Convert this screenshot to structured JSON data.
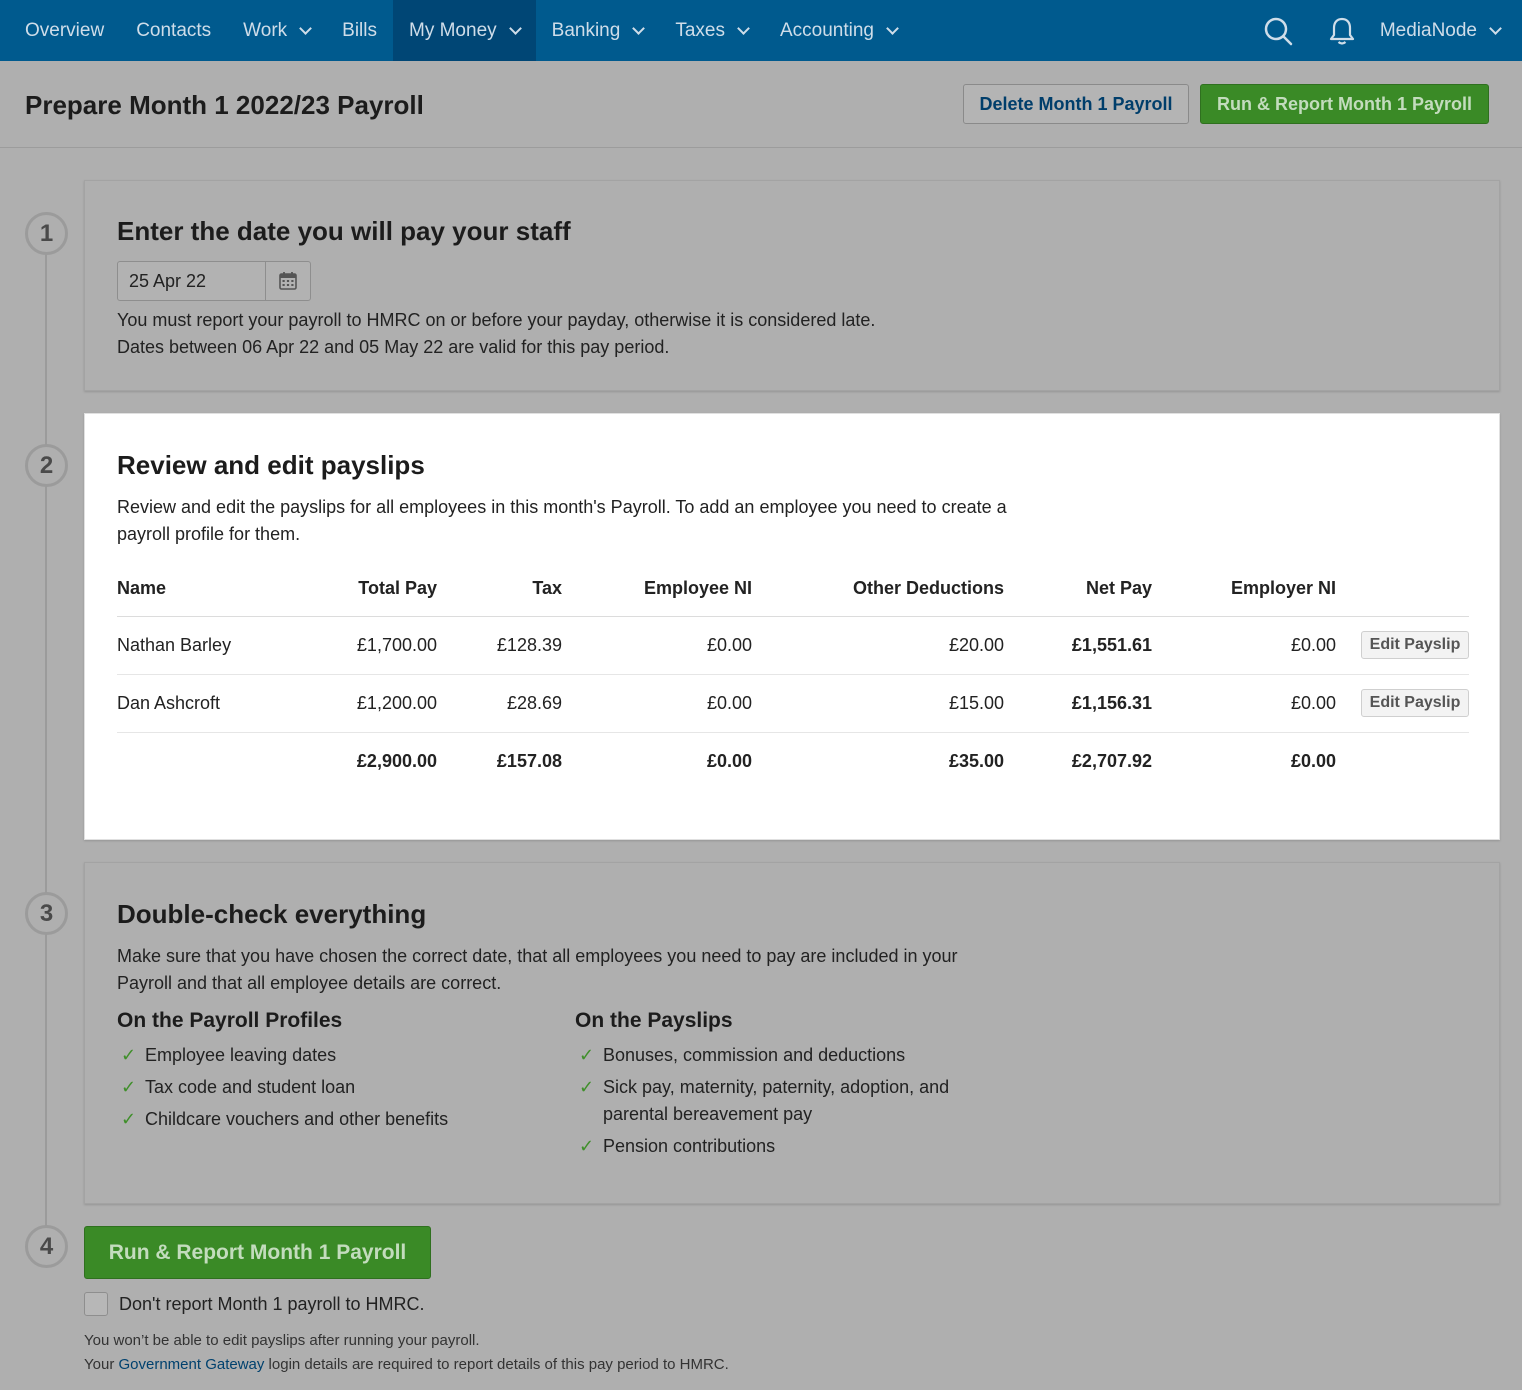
{
  "nav": {
    "items": [
      {
        "label": "Overview",
        "dropdown": false
      },
      {
        "label": "Contacts",
        "dropdown": false
      },
      {
        "label": "Work",
        "dropdown": true
      },
      {
        "label": "Bills",
        "dropdown": false
      },
      {
        "label": "My Money",
        "dropdown": true,
        "active": true
      },
      {
        "label": "Banking",
        "dropdown": true
      },
      {
        "label": "Taxes",
        "dropdown": true
      },
      {
        "label": "Accounting",
        "dropdown": true
      }
    ],
    "org_name": "MediaNode"
  },
  "header": {
    "title": "Prepare Month 1 2022/23 Payroll",
    "delete_label": "Delete Month 1 Payroll",
    "run_label": "Run & Report Month 1 Payroll"
  },
  "steps": {
    "s1": {
      "number": "1",
      "title": "Enter the date you will pay your staff",
      "date_value": "25 Apr 22",
      "line1": "You must report your payroll to HMRC on or before your payday, otherwise it is considered late.",
      "line2": "Dates between 06 Apr 22 and 05 May 22 are valid for this pay period."
    },
    "s2": {
      "number": "2",
      "title": "Review and edit payslips",
      "desc1": "Review and edit the payslips for all employees in this month's Payroll. To add an employee you need to create a",
      "desc2": "payroll profile for them.",
      "columns": {
        "name": "Name",
        "total_pay": "Total Pay",
        "tax": "Tax",
        "employee_ni": "Employee NI",
        "other_deductions": "Other Deductions",
        "net_pay": "Net Pay",
        "employer_ni": "Employer NI"
      },
      "rows": [
        {
          "name": "Nathan Barley",
          "total_pay": "£1,700.00",
          "tax": "£128.39",
          "employee_ni": "£0.00",
          "other_deductions": "£20.00",
          "net_pay": "£1,551.61",
          "employer_ni": "£0.00",
          "edit_label": "Edit Payslip"
        },
        {
          "name": "Dan Ashcroft",
          "total_pay": "£1,200.00",
          "tax": "£28.69",
          "employee_ni": "£0.00",
          "other_deductions": "£15.00",
          "net_pay": "£1,156.31",
          "employer_ni": "£0.00",
          "edit_label": "Edit Payslip"
        }
      ],
      "totals": {
        "total_pay": "£2,900.00",
        "tax": "£157.08",
        "employee_ni": "£0.00",
        "other_deductions": "£35.00",
        "net_pay": "£2,707.92",
        "employer_ni": "£0.00"
      }
    },
    "s3": {
      "number": "3",
      "title": "Double-check everything",
      "desc1": "Make sure that you have chosen the correct date, that all employees you need to pay are included in your",
      "desc2": "Payroll and that all employee details are correct.",
      "profiles_heading": "On the Payroll Profiles",
      "profiles_items": [
        "Employee leaving dates",
        "Tax code and student loan",
        "Childcare vouchers and other benefits"
      ],
      "payslips_heading": "On the Payslips",
      "payslips_items": [
        "Bonuses, commission and deductions",
        "Sick pay, maternity, paternity, adoption, and parental bereavement pay",
        "Pension contributions"
      ]
    },
    "s4": {
      "number": "4",
      "run_label": "Run & Report Month 1 Payroll",
      "checkbox_label": "Don't report Month 1 payroll to HMRC.",
      "note1": "You won’t be able to edit payslips after running your payroll.",
      "note2_prefix": "Your ",
      "note2_link": "Government Gateway",
      "note2_suffix": " login details are required to report details of this pay period to HMRC."
    }
  },
  "colors": {
    "nav_bg": "#005a8e",
    "nav_active": "#004675",
    "primary_green": "#3a8a26",
    "check_green": "#3f8f2a",
    "link_blue": "#00416e"
  },
  "icons": {
    "search": "search-icon",
    "bell": "bell-icon",
    "calendar": "calendar-icon",
    "check": "check-icon"
  }
}
